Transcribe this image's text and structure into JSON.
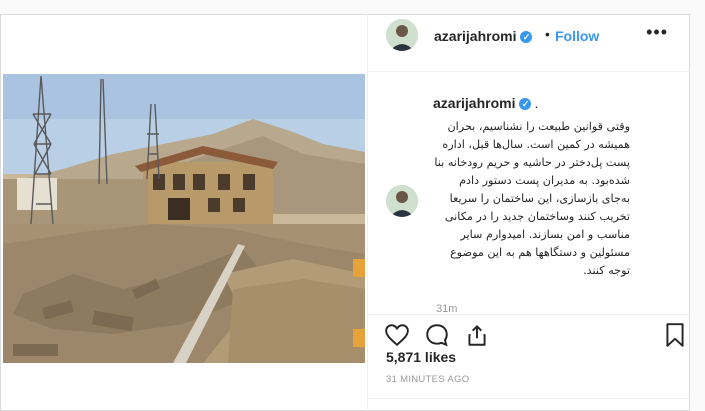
{
  "post": {
    "username": "azarijahromi",
    "follow_label": "Follow",
    "header_separator": "•",
    "more_icon": "ellipsis-icon",
    "caption_period": ".",
    "caption_lines": [
      "وقتی قوانین طبیعت را نشناسیم، بحران",
      "همیشه در کمین است. سال‌ها قبل، اداره",
      "پست پل‌دختر در حاشیه و حریم رودخانه بنا",
      "شده‌بود. به مدیران پست دستور دادم",
      "به‌جای بازسازی، این ساختمان را سریعا",
      "تخریب کنند وساختمان جدید را در مکانی",
      "مناسب و امن بسازند. امیدوارم سایر",
      "مسئولین و دستگاهها هم به این موضوع",
      "توجه کنند."
    ],
    "caption_time": "31m",
    "likes": "5,871 likes",
    "time_ago": "31 MINUTES AGO"
  },
  "colors": {
    "accent": "#3897f0",
    "text": "#262626",
    "muted": "#999999",
    "border": "#dbdbdb"
  },
  "icons": [
    "heart-icon",
    "comment-icon",
    "share-icon",
    "bookmark-icon",
    "verified-badge-icon"
  ]
}
